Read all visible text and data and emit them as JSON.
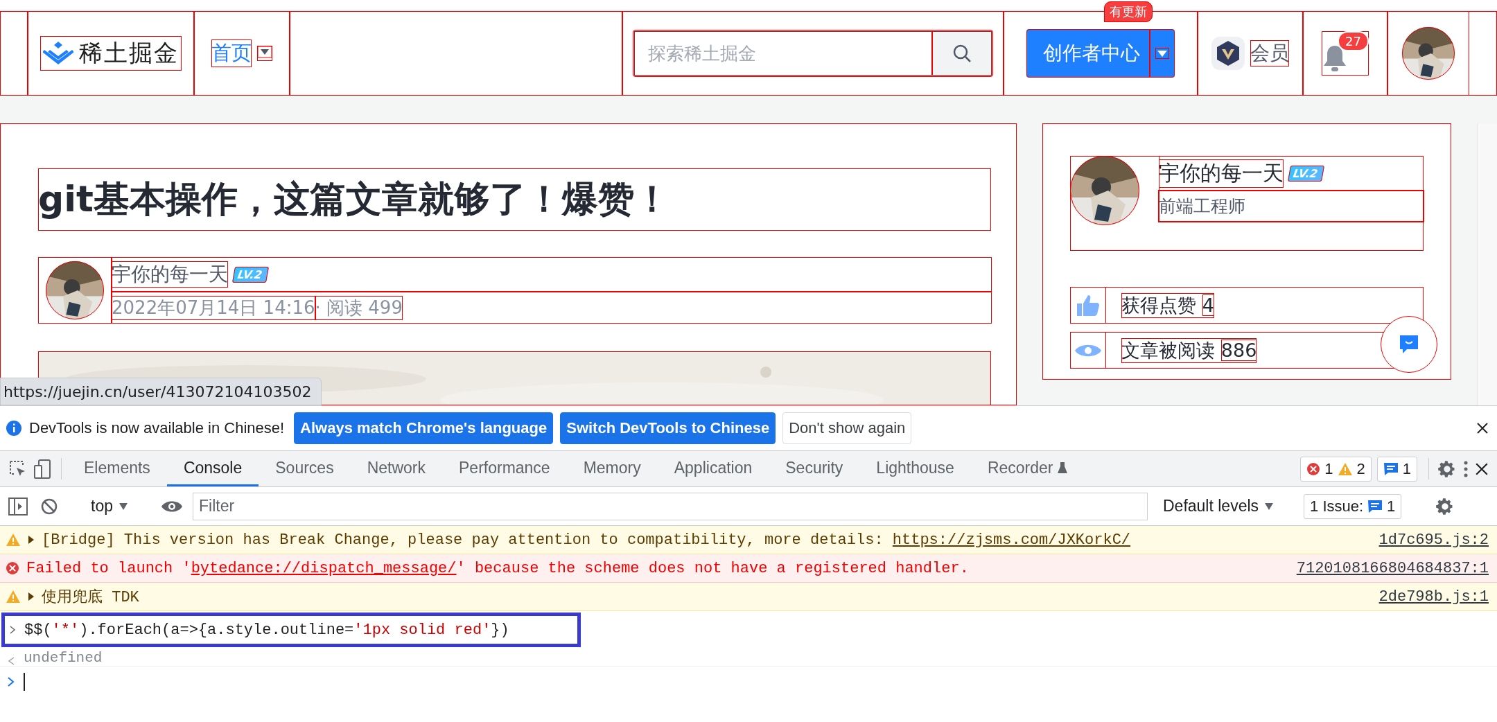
{
  "header": {
    "logo_text": "稀土掘金",
    "nav": [
      {
        "label": "首页",
        "selected": true
      }
    ],
    "search": {
      "placeholder": "探索稀土掘金"
    },
    "creator_button": "创作者中心",
    "update_badge": "有更新",
    "vip_label": "会员",
    "notification_count": "27"
  },
  "article": {
    "title": "git基本操作，这篇文章就够了！爆赞！",
    "author": {
      "name": "宇你的每一天",
      "level": "LV.2"
    },
    "date": "2022年07月14日 14:16",
    "reads": "· 阅读 499"
  },
  "status_url": "https://juejin.cn/user/413072104103502",
  "sidebar": {
    "name": "宇你的每一天",
    "level": "LV.2",
    "job": "前端工程师",
    "stats": [
      {
        "kind": "like",
        "label": "获得点赞",
        "value": "4"
      },
      {
        "kind": "view",
        "label": "文章被阅读",
        "value": "886"
      }
    ]
  },
  "devtools": {
    "infobar": {
      "message": "DevTools is now available in Chinese!",
      "buttons": [
        {
          "label": "Always match Chrome's language",
          "kind": "primary"
        },
        {
          "label": "Switch DevTools to Chinese",
          "kind": "primary"
        },
        {
          "label": "Don't show again",
          "kind": "plain"
        }
      ]
    },
    "tabs": [
      {
        "label": "Elements",
        "selected": false
      },
      {
        "label": "Console",
        "selected": true
      },
      {
        "label": "Sources",
        "selected": false
      },
      {
        "label": "Network",
        "selected": false
      },
      {
        "label": "Performance",
        "selected": false
      },
      {
        "label": "Memory",
        "selected": false
      },
      {
        "label": "Application",
        "selected": false
      },
      {
        "label": "Security",
        "selected": false
      },
      {
        "label": "Lighthouse",
        "selected": false
      },
      {
        "label": "Recorder",
        "selected": false
      }
    ],
    "counts": {
      "errors": "1",
      "warnings": "2",
      "messages": "1"
    },
    "context": "top",
    "filter_placeholder": "Filter",
    "levels": "Default levels",
    "issues_label": "1 Issue:",
    "issues_count": "1",
    "messages": [
      {
        "kind": "warning",
        "expandable": true,
        "text": "[Bridge] This version has Break Change, please pay attention to compatibility, more details: ",
        "link": "https://zjsms.com/JXKorkC/",
        "source": "1d7c695.js:2"
      },
      {
        "kind": "error",
        "expandable": false,
        "text": "Failed to launch '",
        "link": "bytedance://dispatch_message/",
        "after": "' because the scheme does not have a registered handler.",
        "source": "7120108166804684837:1"
      },
      {
        "kind": "warning",
        "expandable": true,
        "text": "使用兜底 TDK",
        "source": "2de798b.js:1"
      }
    ],
    "command": [
      {
        "kind": "code",
        "text": "$$("
      },
      {
        "kind": "string",
        "text": "'*'"
      },
      {
        "kind": "code",
        "text": ").forEach(a=>{a.style.outline="
      },
      {
        "kind": "string",
        "text": "'1px solid red'"
      },
      {
        "kind": "code",
        "text": "})"
      }
    ],
    "result": "undefined"
  }
}
